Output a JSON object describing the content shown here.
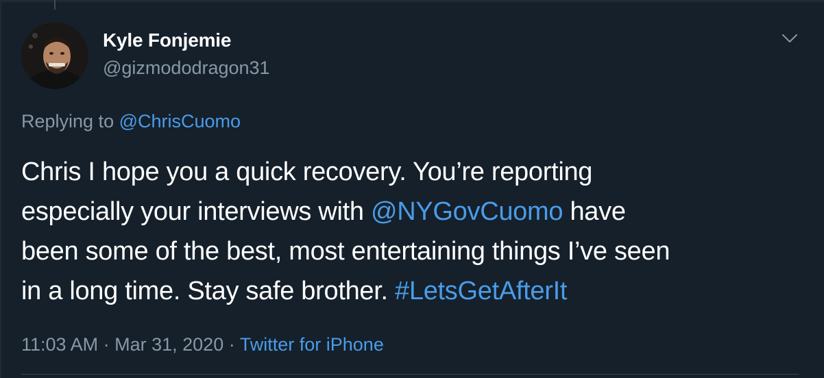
{
  "tweet": {
    "author_name": "Kyle Fonjemie",
    "author_handle": "@gizmododragon31",
    "replying_prefix": "Replying to",
    "replying_to": "@ChrisCuomo",
    "text_lines": [
      [
        "Chris I hope you a quick recovery. You’re reporting"
      ],
      [
        "especially your interviews with ",
        "@NYGovCuomo",
        " have"
      ],
      [
        "been some of the best, most entertaining things I’ve seen"
      ],
      [
        "in a long time. Stay safe brother. ",
        "#LetsGetAfterIt"
      ]
    ],
    "time": "11:03 AM",
    "separator": "·",
    "date": "Mar 31, 2020",
    "source": "Twitter for iPhone"
  },
  "icons": {
    "more": "chevron-down-icon",
    "avatar": "avatar"
  },
  "colors": {
    "background": "#15202b",
    "primary_text": "#ffffff",
    "secondary_text": "#8899a6",
    "link": "#4a9ce8",
    "divider": "#38444d"
  }
}
